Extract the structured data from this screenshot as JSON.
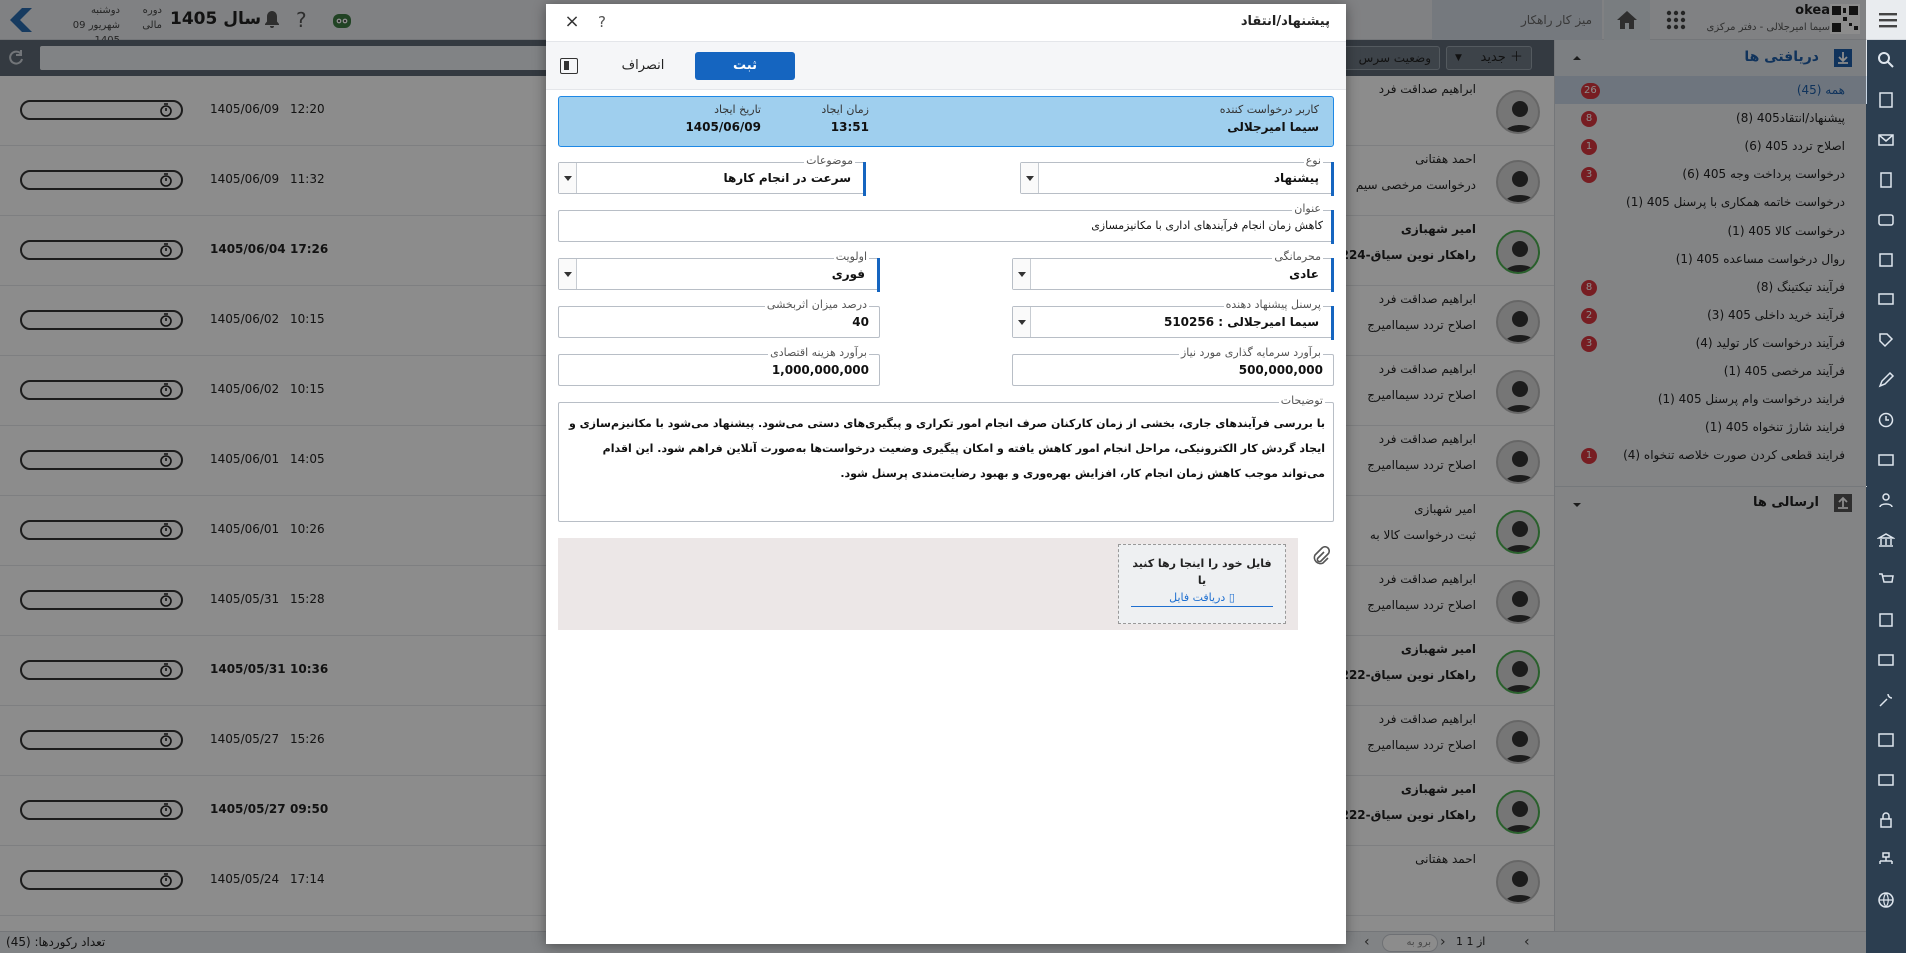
{
  "topbar": {
    "weekday": "دوشنبه",
    "date": "09 شهریور 1405",
    "period_line1": "دوره",
    "period_line2": "مالی",
    "year": "سال 1405",
    "desk_tab": "میز کار راهکار",
    "user_name": "okea",
    "user_sub": "سیما امیرجلالی - دفتر مرکزی"
  },
  "toolbar": {
    "new_label": "جدید",
    "status_label": "وضعیت سرس"
  },
  "inbox": {
    "title": "دریافتی ها",
    "sent_title": "ارسالی ها",
    "items": [
      {
        "label": "همه (45)",
        "badge": "26"
      },
      {
        "label": "پیشنهاد/انتقاد405 (8)",
        "badge": "8"
      },
      {
        "label": "اصلاح تردد 405 (6)",
        "badge": "1"
      },
      {
        "label": "درخواست پرداخت وجه 405 (6)",
        "badge": "3"
      },
      {
        "label": "درخواست خاتمه همکاری با پرسنل 405 (1)",
        "badge": ""
      },
      {
        "label": "درخواست کالا 405 (1)",
        "badge": ""
      },
      {
        "label": "روال درخواست مساعده 405 (1)",
        "badge": ""
      },
      {
        "label": "فرآیند تیکتینگ (8)",
        "badge": "8"
      },
      {
        "label": "فرآیند خرید داخلی 405 (3)",
        "badge": "2"
      },
      {
        "label": "فرآیند درخواست کار تولید (4)",
        "badge": "3"
      },
      {
        "label": "فرآیند مرخصی 405 (1)",
        "badge": ""
      },
      {
        "label": "فرایند درخواست وام پرسنل 405 (1)",
        "badge": ""
      },
      {
        "label": "فرایند شارژ تنخواه 405 (1)",
        "badge": ""
      },
      {
        "label": "فرایند قطعی کردن صورت خلاصه تنخواه (4)",
        "badge": "1"
      }
    ]
  },
  "list": {
    "rows": [
      {
        "date": "1405/06/09",
        "time": "12:20",
        "name": "ابراهیم صداقت فرد",
        "sub": "",
        "bold": false,
        "green": false
      },
      {
        "date": "1405/06/09",
        "time": "11:32",
        "name": "احمد هفتانی",
        "sub": "درخواست مرخصی سیم",
        "bold": false,
        "green": false
      },
      {
        "date": "1405/06/04",
        "time": "17:26",
        "name": "امیر شهبازی",
        "sub": "224-راهکار نوین سیاق",
        "bold": true,
        "green": true
      },
      {
        "date": "1405/06/02",
        "time": "10:15",
        "name": "ابراهیم صداقت فرد",
        "sub": "اصلاح تردد سیماامیرج",
        "bold": false,
        "green": false
      },
      {
        "date": "1405/06/02",
        "time": "10:15",
        "name": "ابراهیم صداقت فرد",
        "sub": "اصلاح تردد سیماامیرج",
        "bold": false,
        "green": false
      },
      {
        "date": "1405/06/01",
        "time": "14:05",
        "name": "ابراهیم صداقت فرد",
        "sub": "اصلاح تردد سیماامیرج",
        "bold": false,
        "green": false
      },
      {
        "date": "1405/06/01",
        "time": "10:26",
        "name": "امیر شهبازی",
        "sub": "ثبت درخواست کالا به",
        "bold": false,
        "green": true
      },
      {
        "date": "1405/05/31",
        "time": "15:28",
        "name": "ابراهیم صداقت فرد",
        "sub": "اصلاح تردد سیماامیرج",
        "bold": false,
        "green": false
      },
      {
        "date": "1405/05/31",
        "time": "10:36",
        "name": "امیر شهبازی",
        "sub": "222-راهکار نوین سیاق",
        "bold": true,
        "green": true
      },
      {
        "date": "1405/05/27",
        "time": "15:26",
        "name": "ابراهیم صداقت فرد",
        "sub": "اصلاح تردد سیماامیرج",
        "bold": false,
        "green": false
      },
      {
        "date": "1405/05/27",
        "time": "09:50",
        "name": "امیر شهبازی",
        "sub": "222-راهکار نوین سیاق",
        "bold": true,
        "green": true
      },
      {
        "date": "1405/05/24",
        "time": "17:14",
        "name": "احمد هفتانی",
        "sub": "",
        "bold": false,
        "green": false
      }
    ]
  },
  "footer": {
    "count": "تعداد رکوردها: (45)",
    "page_text": "1  از  1",
    "goto": "برو به"
  },
  "modal": {
    "title": "پیشنهاد/انتقاد",
    "help": "?",
    "close": "×",
    "save": "ثبت",
    "cancel": "انصراف",
    "info": {
      "requester_label": "کاربر درخواست کننده",
      "requester_value": "سیما امیرجلالی",
      "time_label": "زمان ایجاد",
      "time_value": "13:51",
      "date_label": "تاریخ ایجاد",
      "date_value": "1405/06/09"
    },
    "fields": {
      "type_label": "نوع",
      "type_value": "پیشنهاد",
      "topics_label": "موضوعات",
      "topics_value": "سرعت در انجام کارها",
      "title_label": "عنوان",
      "title_value": "کاهش زمان انجام فرآیندهای اداری با مکانیزمسازی",
      "privacy_label": "محرمانگی",
      "privacy_value": "عادی",
      "priority_label": "اولویت",
      "priority_value": "فوری",
      "proposer_label": "پرسنل پیشنهاد دهنده",
      "proposer_value": "510256 : سیما امیرجلالی",
      "effectiveness_label": "درصد میزان اثربخشی",
      "effectiveness_value": "40",
      "investment_label": "برآورد سرمایه گذاری مورد نیاز",
      "investment_value": "500,000,000",
      "cost_label": "برآورد هزینه اقتصادی",
      "cost_value": "1,000,000,000",
      "desc_label": "توضیحات",
      "desc_value": "با بررسی فرآیندهای جاری، بخشی از زمان کارکنان صرف انجام امور تکراری و پیگیری‌های دستی می‌شود. پیشنهاد می‌شود با مکانیزم‌سازی و ایجاد گردش کار الکترونیکی، مراحل انجام امور کاهش یافته و امکان پیگیری وضعیت درخواست‌ها به‌صورت آنلاین فراهم شود. این اقدام می‌تواند موجب کاهش زمان انجام کار، افزایش بهره‌وری و بهبود رضایت‌مندی پرسنل شود."
    },
    "attach": {
      "drop_text": "فایل خود را اینجا رها کنید",
      "or_text": "یا",
      "receive_text": "دریافت فایل"
    }
  },
  "colors": {
    "accent": "#1565c0",
    "info_bg": "#9fcfee",
    "badge": "#d9363e",
    "rail": "#2c3e50"
  }
}
